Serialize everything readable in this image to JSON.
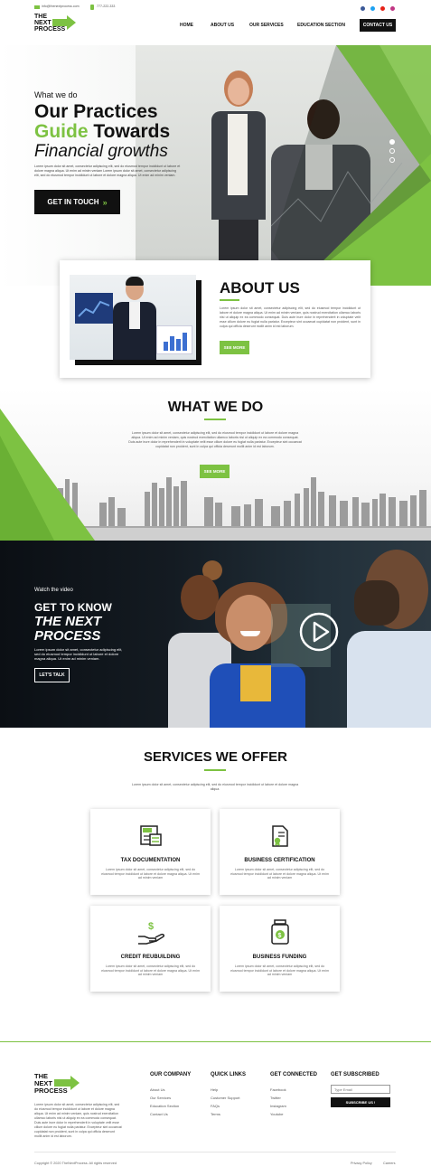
{
  "topbar": {
    "email": "info@thenextprocess.com",
    "phone": "777-222-333"
  },
  "logo": {
    "line1": "THE",
    "line2": "NEXT",
    "line3": "PROCESS"
  },
  "nav": {
    "items": [
      "HOME",
      "ABOUT US",
      "OUR SERVICES",
      "EDUCATION SECTION"
    ],
    "cta": "CONTACT US"
  },
  "hero": {
    "kicker": "What we do",
    "title_line1": "Our Practices",
    "title_green": "Guide",
    "title_line2_rest": "Towards",
    "title_line3": "Financial growths",
    "desc": "Lorem ipsum dolor sit amet, consectetur adipiscing elit, sed do eiusmod tempor incididunt ut labore et dolore magna aliqua. Ut enim ad minim veniam Lorem ipsum dolor sit amet, consectetur adipiscing elit, sed do eiusmod tempor incididunt ut labore et dolore magna aliqua. Ut enim ad minim veniam.",
    "button": "GET IN TOUCH"
  },
  "about": {
    "title": "ABOUT US",
    "desc": "Lorem ipsum dolor sit amet, consectetur adipiscing elit, sed do eiusmod tempor incididunt ut labore et dolore magna aliqua. Ut enim ad minim veniam, quis nostrud exercitation ullamco laboris nisi ut aliquip ex ea commodo consequat. Duis aute irure dolor in reprehenderit in voluptate velit esse cillum dolore eu fugiat nulla pariatur. Excepteur sint occaecat cupidatat non proident, sunt in culpa qui officia deserunt mollit anim id est laborum.",
    "button": "SEE MORE"
  },
  "whatwedo": {
    "title": "WHAT WE DO",
    "desc": "Lorem ipsum dolor sit amet, consectetur adipiscing elit, sed do eiusmod tempor incididunt ut labore et dolore magna aliqua. Ut enim ad minim veniam, quis nostrud exercitation ullamco laboris nisi ut aliquip ex ea commodo consequat. Duis aute irure dolor in reprehenderit in voluptate velit esse cillum dolore eu fugiat nulla pariatur. Excepteur sint occaecat cupidatat non proident, sunt in culpa qui officia deserunt mollit anim id est laborum.",
    "button": "SEE MORE"
  },
  "video": {
    "kicker": "Watch the video",
    "title1": "GET TO KNOW",
    "title2": "THE NEXT",
    "title3": "PROCESS",
    "desc": "Lorem ipsum dolor sit amet, consectetur adipiscing elit, sed do eiusmod tempor incididunt ut labore et dolore magna aliqua. Ut enim ad minim veniam.",
    "button": "LET'S TALK"
  },
  "services": {
    "title": "SERVICES WE OFFER",
    "desc": "Lorem ipsum dolor sit amet, consectetur adipiscing elit, sed do eiusmod tempor incididunt ut labore et dolore magna aliqua.",
    "items": [
      {
        "title": "TAX DOCUMENTATION",
        "desc": "Lorem ipsum dolor sit amet, consectetur adipiscing elit, sed do eiusmod tempor incididunt ut labore et dolore magna aliqua. Ut enim ad minim veniam",
        "icon": "tax-icon"
      },
      {
        "title": "BUSINESS CERTIFICATION",
        "desc": "Lorem ipsum dolor sit amet, consectetur adipiscing elit, sed do eiusmod tempor incididunt ut labore et dolore magna aliqua. Ut enim ad minim veniam",
        "icon": "certificate-icon"
      },
      {
        "title": "CREDIT REUBUILDING",
        "desc": "Lorem ipsum dolor sit amet, consectetur adipiscing elit, sed do eiusmod tempor incididunt ut labore et dolore magna aliqua. Ut enim ad minim veniam",
        "icon": "money-hand-icon"
      },
      {
        "title": "BUSINESS FUNDING",
        "desc": "Lorem ipsum dolor sit amet, consectetur adipiscing elit, sed do eiusmod tempor incididunt ut labore et dolore magna aliqua. Ut enim ad minim veniam",
        "icon": "money-jar-icon"
      }
    ]
  },
  "footer": {
    "about": "Lorem ipsum dolor sit amet, consectetur adipiscing elit, sed do eiusmod tempor incididunt ut labore et dolore magna aliqua. Ut enim ad minim veniam, quis nostrud exercitation ullamco laboris nisi ut aliquip ex ea commodo consequat. Duis aute irure dolor in reprehenderit in voluptate velit esse cillum dolore eu fugiat nulla pariatur. Excepteur sint occaecat cupidatat non proident, sunt in culpa qui officia deserunt mollit anim id est laborum.",
    "col1": {
      "title": "OUR COMPANY",
      "links": [
        "About Us",
        "Our Services",
        "Education Section",
        "Contact Us"
      ]
    },
    "col2": {
      "title": "QUICK LINKS",
      "links": [
        "Help",
        "Customer Support",
        "FAQs",
        "Terms"
      ]
    },
    "col3": {
      "title": "GET CONNECTED",
      "links": [
        "Facebook",
        "Twitter",
        "Instagram",
        "Youtube"
      ]
    },
    "subscribe": {
      "title": "GET SUBSCRIBED",
      "placeholder": "Type Email",
      "button": "SUBSCRIBE US !"
    },
    "copyright": "Copyright © 2020 TheNextProcess. All rights reserved",
    "privacy": "Privacy Policy",
    "careers": "Careers"
  },
  "colors": {
    "accent": "#7dc242",
    "dark": "#111111"
  }
}
